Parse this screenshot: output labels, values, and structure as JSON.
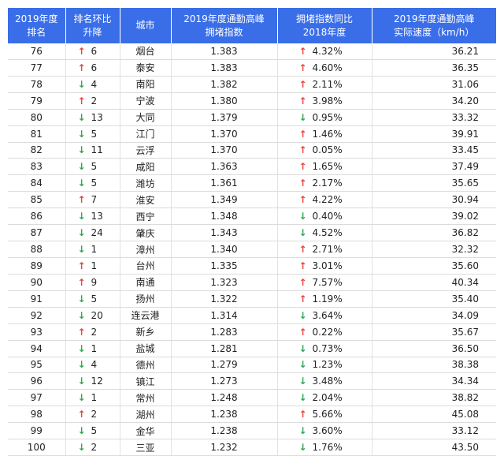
{
  "header": {
    "col_rank": [
      "2019年度",
      "排名"
    ],
    "col_change": [
      "排名环比",
      "升降"
    ],
    "col_city": "城市",
    "col_index": [
      "2019年度通勤高峰",
      "拥堵指数"
    ],
    "col_yoy": [
      "拥堵指数同比",
      "2018年度"
    ],
    "col_speed": [
      "2019年度通勤高峰",
      "实际速度（km/h）"
    ]
  },
  "colors": {
    "header_bg": "#3a6ee8",
    "up": "#e8443a",
    "down": "#2fa84f"
  },
  "arrows": {
    "up": "↑",
    "down": "↓"
  },
  "rows": [
    {
      "rank": "76",
      "dir": "up",
      "change": "6",
      "city": "烟台",
      "index": "1.383",
      "yoy_dir": "up",
      "yoy": "4.32%",
      "speed": "36.21"
    },
    {
      "rank": "77",
      "dir": "up",
      "change": "6",
      "city": "泰安",
      "index": "1.383",
      "yoy_dir": "up",
      "yoy": "4.60%",
      "speed": "36.35"
    },
    {
      "rank": "78",
      "dir": "down",
      "change": "4",
      "city": "南阳",
      "index": "1.382",
      "yoy_dir": "up",
      "yoy": "2.11%",
      "speed": "31.06"
    },
    {
      "rank": "79",
      "dir": "up",
      "change": "2",
      "city": "宁波",
      "index": "1.380",
      "yoy_dir": "up",
      "yoy": "3.98%",
      "speed": "34.20"
    },
    {
      "rank": "80",
      "dir": "down",
      "change": "13",
      "city": "大同",
      "index": "1.379",
      "yoy_dir": "down",
      "yoy": "0.95%",
      "speed": "33.32"
    },
    {
      "rank": "81",
      "dir": "down",
      "change": "5",
      "city": "江门",
      "index": "1.370",
      "yoy_dir": "up",
      "yoy": "1.46%",
      "speed": "39.91"
    },
    {
      "rank": "82",
      "dir": "down",
      "change": "11",
      "city": "云浮",
      "index": "1.370",
      "yoy_dir": "up",
      "yoy": "0.05%",
      "speed": "33.45"
    },
    {
      "rank": "83",
      "dir": "down",
      "change": "5",
      "city": "咸阳",
      "index": "1.363",
      "yoy_dir": "up",
      "yoy": "1.65%",
      "speed": "37.49"
    },
    {
      "rank": "84",
      "dir": "down",
      "change": "5",
      "city": "潍坊",
      "index": "1.361",
      "yoy_dir": "up",
      "yoy": "2.17%",
      "speed": "35.65"
    },
    {
      "rank": "85",
      "dir": "up",
      "change": "7",
      "city": "淮安",
      "index": "1.349",
      "yoy_dir": "up",
      "yoy": "4.22%",
      "speed": "30.94"
    },
    {
      "rank": "86",
      "dir": "down",
      "change": "13",
      "city": "西宁",
      "index": "1.348",
      "yoy_dir": "down",
      "yoy": "0.40%",
      "speed": "39.02"
    },
    {
      "rank": "87",
      "dir": "down",
      "change": "24",
      "city": "肇庆",
      "index": "1.343",
      "yoy_dir": "down",
      "yoy": "4.52%",
      "speed": "36.82"
    },
    {
      "rank": "88",
      "dir": "down",
      "change": "1",
      "city": "漳州",
      "index": "1.340",
      "yoy_dir": "up",
      "yoy": "2.71%",
      "speed": "32.32"
    },
    {
      "rank": "89",
      "dir": "up",
      "change": "1",
      "city": "台州",
      "index": "1.335",
      "yoy_dir": "up",
      "yoy": "3.01%",
      "speed": "35.60"
    },
    {
      "rank": "90",
      "dir": "up",
      "change": "9",
      "city": "南通",
      "index": "1.323",
      "yoy_dir": "up",
      "yoy": "7.57%",
      "speed": "40.34"
    },
    {
      "rank": "91",
      "dir": "down",
      "change": "5",
      "city": "扬州",
      "index": "1.322",
      "yoy_dir": "up",
      "yoy": "1.19%",
      "speed": "35.40"
    },
    {
      "rank": "92",
      "dir": "down",
      "change": "20",
      "city": "连云港",
      "index": "1.314",
      "yoy_dir": "down",
      "yoy": "3.64%",
      "speed": "34.09"
    },
    {
      "rank": "93",
      "dir": "up",
      "change": "2",
      "city": "新乡",
      "index": "1.283",
      "yoy_dir": "up",
      "yoy": "0.22%",
      "speed": "35.67"
    },
    {
      "rank": "94",
      "dir": "down",
      "change": "1",
      "city": "盐城",
      "index": "1.281",
      "yoy_dir": "down",
      "yoy": "0.73%",
      "speed": "36.50"
    },
    {
      "rank": "95",
      "dir": "down",
      "change": "4",
      "city": "德州",
      "index": "1.279",
      "yoy_dir": "down",
      "yoy": "1.23%",
      "speed": "38.38"
    },
    {
      "rank": "96",
      "dir": "down",
      "change": "12",
      "city": "镇江",
      "index": "1.273",
      "yoy_dir": "down",
      "yoy": "3.48%",
      "speed": "34.34"
    },
    {
      "rank": "97",
      "dir": "down",
      "change": "1",
      "city": "常州",
      "index": "1.248",
      "yoy_dir": "down",
      "yoy": "2.04%",
      "speed": "38.82"
    },
    {
      "rank": "98",
      "dir": "up",
      "change": "2",
      "city": "湖州",
      "index": "1.238",
      "yoy_dir": "up",
      "yoy": "5.66%",
      "speed": "45.08"
    },
    {
      "rank": "99",
      "dir": "down",
      "change": "5",
      "city": "金华",
      "index": "1.238",
      "yoy_dir": "down",
      "yoy": "3.60%",
      "speed": "33.12"
    },
    {
      "rank": "100",
      "dir": "down",
      "change": "2",
      "city": "三亚",
      "index": "1.232",
      "yoy_dir": "down",
      "yoy": "1.76%",
      "speed": "43.50"
    }
  ]
}
